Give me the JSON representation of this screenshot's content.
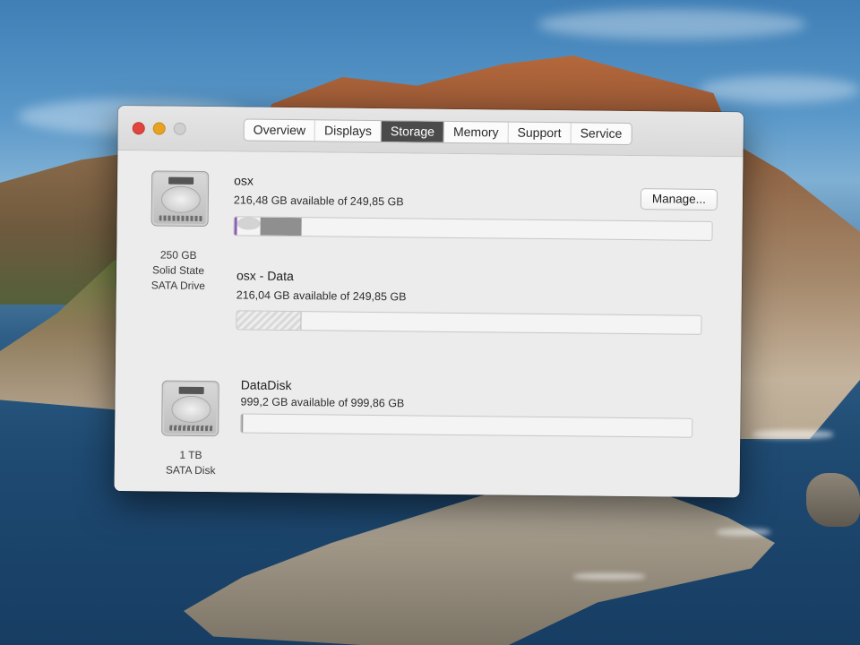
{
  "window": {
    "tabs": [
      "Overview",
      "Displays",
      "Storage",
      "Memory",
      "Support",
      "Service"
    ],
    "active_tab": "Storage"
  },
  "drives": [
    {
      "caption": [
        "250 GB",
        "Solid State",
        "SATA Drive"
      ],
      "volumes": [
        {
          "name": "osx",
          "available": "216,48 GB available of 249,85 GB",
          "used_fraction": 0.134
        },
        {
          "name": "osx - Data",
          "available": "216,04 GB available of 249,85 GB",
          "used_fraction": 0.135
        }
      ]
    },
    {
      "caption": [
        "1 TB",
        "SATA Disk"
      ],
      "volumes": [
        {
          "name": "DataDisk",
          "available": "999,2 GB available of 999,86 GB",
          "used_fraction": 0.001
        }
      ]
    }
  ],
  "buttons": {
    "manage": "Manage..."
  },
  "colors": {
    "close": "#e0443e",
    "minimize": "#e8a221",
    "zoom": "#cfcfcf",
    "active_tab": "#4b4b4b",
    "bar_purple": "#8a5fb5",
    "bar_used": "#8f8f8f"
  }
}
